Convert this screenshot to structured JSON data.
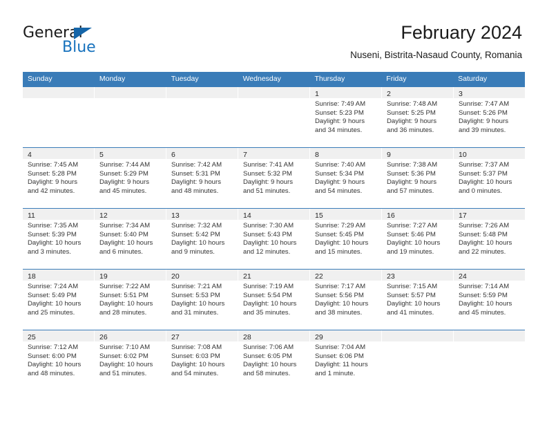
{
  "brand": {
    "word_one": "General",
    "word_two": "Blue",
    "triangle_icon": "blue-triangle-logo",
    "accent_color": "#1772bd"
  },
  "header": {
    "title": "February 2024",
    "subtitle": "Nuseni, Bistrita-Nasaud County, Romania"
  },
  "theme": {
    "header_row_bg": "#3a7cb8",
    "day_band_bg": "#f0f0f0",
    "row_divider": "#3a7cb8",
    "text_color": "#333333"
  },
  "calendar": {
    "weekdays": [
      "Sunday",
      "Monday",
      "Tuesday",
      "Wednesday",
      "Thursday",
      "Friday",
      "Saturday"
    ],
    "weeks": [
      [
        {
          "day": "",
          "empty": true
        },
        {
          "day": "",
          "empty": true
        },
        {
          "day": "",
          "empty": true
        },
        {
          "day": "",
          "empty": true
        },
        {
          "day": "1",
          "sunrise": "Sunrise: 7:49 AM",
          "sunset": "Sunset: 5:23 PM",
          "daylight_1": "Daylight: 9 hours",
          "daylight_2": "and 34 minutes."
        },
        {
          "day": "2",
          "sunrise": "Sunrise: 7:48 AM",
          "sunset": "Sunset: 5:25 PM",
          "daylight_1": "Daylight: 9 hours",
          "daylight_2": "and 36 minutes."
        },
        {
          "day": "3",
          "sunrise": "Sunrise: 7:47 AM",
          "sunset": "Sunset: 5:26 PM",
          "daylight_1": "Daylight: 9 hours",
          "daylight_2": "and 39 minutes."
        }
      ],
      [
        {
          "day": "4",
          "sunrise": "Sunrise: 7:45 AM",
          "sunset": "Sunset: 5:28 PM",
          "daylight_1": "Daylight: 9 hours",
          "daylight_2": "and 42 minutes."
        },
        {
          "day": "5",
          "sunrise": "Sunrise: 7:44 AM",
          "sunset": "Sunset: 5:29 PM",
          "daylight_1": "Daylight: 9 hours",
          "daylight_2": "and 45 minutes."
        },
        {
          "day": "6",
          "sunrise": "Sunrise: 7:42 AM",
          "sunset": "Sunset: 5:31 PM",
          "daylight_1": "Daylight: 9 hours",
          "daylight_2": "and 48 minutes."
        },
        {
          "day": "7",
          "sunrise": "Sunrise: 7:41 AM",
          "sunset": "Sunset: 5:32 PM",
          "daylight_1": "Daylight: 9 hours",
          "daylight_2": "and 51 minutes."
        },
        {
          "day": "8",
          "sunrise": "Sunrise: 7:40 AM",
          "sunset": "Sunset: 5:34 PM",
          "daylight_1": "Daylight: 9 hours",
          "daylight_2": "and 54 minutes."
        },
        {
          "day": "9",
          "sunrise": "Sunrise: 7:38 AM",
          "sunset": "Sunset: 5:36 PM",
          "daylight_1": "Daylight: 9 hours",
          "daylight_2": "and 57 minutes."
        },
        {
          "day": "10",
          "sunrise": "Sunrise: 7:37 AM",
          "sunset": "Sunset: 5:37 PM",
          "daylight_1": "Daylight: 10 hours",
          "daylight_2": "and 0 minutes."
        }
      ],
      [
        {
          "day": "11",
          "sunrise": "Sunrise: 7:35 AM",
          "sunset": "Sunset: 5:39 PM",
          "daylight_1": "Daylight: 10 hours",
          "daylight_2": "and 3 minutes."
        },
        {
          "day": "12",
          "sunrise": "Sunrise: 7:34 AM",
          "sunset": "Sunset: 5:40 PM",
          "daylight_1": "Daylight: 10 hours",
          "daylight_2": "and 6 minutes."
        },
        {
          "day": "13",
          "sunrise": "Sunrise: 7:32 AM",
          "sunset": "Sunset: 5:42 PM",
          "daylight_1": "Daylight: 10 hours",
          "daylight_2": "and 9 minutes."
        },
        {
          "day": "14",
          "sunrise": "Sunrise: 7:30 AM",
          "sunset": "Sunset: 5:43 PM",
          "daylight_1": "Daylight: 10 hours",
          "daylight_2": "and 12 minutes."
        },
        {
          "day": "15",
          "sunrise": "Sunrise: 7:29 AM",
          "sunset": "Sunset: 5:45 PM",
          "daylight_1": "Daylight: 10 hours",
          "daylight_2": "and 15 minutes."
        },
        {
          "day": "16",
          "sunrise": "Sunrise: 7:27 AM",
          "sunset": "Sunset: 5:46 PM",
          "daylight_1": "Daylight: 10 hours",
          "daylight_2": "and 19 minutes."
        },
        {
          "day": "17",
          "sunrise": "Sunrise: 7:26 AM",
          "sunset": "Sunset: 5:48 PM",
          "daylight_1": "Daylight: 10 hours",
          "daylight_2": "and 22 minutes."
        }
      ],
      [
        {
          "day": "18",
          "sunrise": "Sunrise: 7:24 AM",
          "sunset": "Sunset: 5:49 PM",
          "daylight_1": "Daylight: 10 hours",
          "daylight_2": "and 25 minutes."
        },
        {
          "day": "19",
          "sunrise": "Sunrise: 7:22 AM",
          "sunset": "Sunset: 5:51 PM",
          "daylight_1": "Daylight: 10 hours",
          "daylight_2": "and 28 minutes."
        },
        {
          "day": "20",
          "sunrise": "Sunrise: 7:21 AM",
          "sunset": "Sunset: 5:53 PM",
          "daylight_1": "Daylight: 10 hours",
          "daylight_2": "and 31 minutes."
        },
        {
          "day": "21",
          "sunrise": "Sunrise: 7:19 AM",
          "sunset": "Sunset: 5:54 PM",
          "daylight_1": "Daylight: 10 hours",
          "daylight_2": "and 35 minutes."
        },
        {
          "day": "22",
          "sunrise": "Sunrise: 7:17 AM",
          "sunset": "Sunset: 5:56 PM",
          "daylight_1": "Daylight: 10 hours",
          "daylight_2": "and 38 minutes."
        },
        {
          "day": "23",
          "sunrise": "Sunrise: 7:15 AM",
          "sunset": "Sunset: 5:57 PM",
          "daylight_1": "Daylight: 10 hours",
          "daylight_2": "and 41 minutes."
        },
        {
          "day": "24",
          "sunrise": "Sunrise: 7:14 AM",
          "sunset": "Sunset: 5:59 PM",
          "daylight_1": "Daylight: 10 hours",
          "daylight_2": "and 45 minutes."
        }
      ],
      [
        {
          "day": "25",
          "sunrise": "Sunrise: 7:12 AM",
          "sunset": "Sunset: 6:00 PM",
          "daylight_1": "Daylight: 10 hours",
          "daylight_2": "and 48 minutes."
        },
        {
          "day": "26",
          "sunrise": "Sunrise: 7:10 AM",
          "sunset": "Sunset: 6:02 PM",
          "daylight_1": "Daylight: 10 hours",
          "daylight_2": "and 51 minutes."
        },
        {
          "day": "27",
          "sunrise": "Sunrise: 7:08 AM",
          "sunset": "Sunset: 6:03 PM",
          "daylight_1": "Daylight: 10 hours",
          "daylight_2": "and 54 minutes."
        },
        {
          "day": "28",
          "sunrise": "Sunrise: 7:06 AM",
          "sunset": "Sunset: 6:05 PM",
          "daylight_1": "Daylight: 10 hours",
          "daylight_2": "and 58 minutes."
        },
        {
          "day": "29",
          "sunrise": "Sunrise: 7:04 AM",
          "sunset": "Sunset: 6:06 PM",
          "daylight_1": "Daylight: 11 hours",
          "daylight_2": "and 1 minute."
        },
        {
          "day": "",
          "empty": true
        },
        {
          "day": "",
          "empty": true
        }
      ]
    ]
  }
}
